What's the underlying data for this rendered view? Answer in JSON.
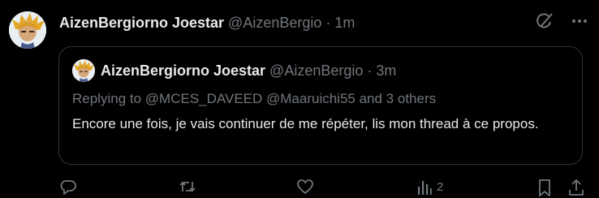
{
  "tweet": {
    "author_name": "AizenBergiorno Joestar",
    "author_handle": "@AizenBergio",
    "separator": "·",
    "time": "1m",
    "avatar_icon": "avatar-anime-character"
  },
  "quote": {
    "author_name": "AizenBergiorno Joestar",
    "author_handle": "@AizenBergio",
    "separator": "·",
    "time": "3m",
    "replying_prefix": "Replying to",
    "replying_mentions": "@MCES_DAVEED @Maaruichi55",
    "replying_suffix": "and 3 others",
    "text": "Encore une fois, je vais continuer de me répéter, lis mon thread à ce propos."
  },
  "actions": {
    "reply_icon": "reply-icon",
    "retweet_icon": "retweet-icon",
    "like_icon": "like-icon",
    "views_icon": "views-icon",
    "views_count": "2",
    "bookmark_icon": "bookmark-icon",
    "share_icon": "share-icon"
  },
  "top_icons": [
    "grok-icon",
    "more-icon"
  ],
  "colors": {
    "background": "#000000",
    "text_primary": "#e7e9ea",
    "text_secondary": "#71767b",
    "border": "#2f3336"
  }
}
